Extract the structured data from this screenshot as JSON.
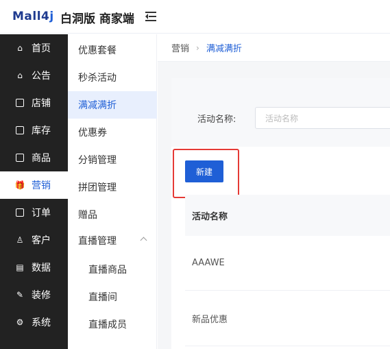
{
  "header": {
    "logo_text": "Mall4",
    "logo_suffix": "j",
    "brand": "白洞版 商家端"
  },
  "sidebar": {
    "items": [
      {
        "label": "首页",
        "icon": "home-icon"
      },
      {
        "label": "公告",
        "icon": "notice-icon"
      },
      {
        "label": "店铺",
        "icon": "shop-icon"
      },
      {
        "label": "库存",
        "icon": "stock-icon"
      },
      {
        "label": "商品",
        "icon": "goods-icon"
      },
      {
        "label": "营销",
        "icon": "gift-icon"
      },
      {
        "label": "订单",
        "icon": "order-icon"
      },
      {
        "label": "客户",
        "icon": "user-icon"
      },
      {
        "label": "数据",
        "icon": "data-icon"
      },
      {
        "label": "装修",
        "icon": "decorate-icon"
      },
      {
        "label": "系统",
        "icon": "settings-icon"
      }
    ]
  },
  "submenu": {
    "items": [
      {
        "label": "优惠套餐"
      },
      {
        "label": "秒杀活动"
      },
      {
        "label": "满减满折"
      },
      {
        "label": "优惠券"
      },
      {
        "label": "分销管理"
      },
      {
        "label": "拼团管理"
      },
      {
        "label": "赠品"
      },
      {
        "label": "直播管理"
      },
      {
        "label": "直播商品"
      },
      {
        "label": "直播间"
      },
      {
        "label": "直播成员"
      }
    ]
  },
  "breadcrumb": {
    "parent": "营销",
    "current": "满减满折"
  },
  "search": {
    "label": "活动名称:",
    "placeholder": "活动名称"
  },
  "toolbar": {
    "new_label": "新建"
  },
  "table": {
    "header": "活动名称",
    "rows": [
      "AAAWE",
      "新品优惠"
    ]
  },
  "colors": {
    "accent": "#1f5fd6",
    "sidebar_bg": "#222222",
    "highlight": "#e53935"
  }
}
